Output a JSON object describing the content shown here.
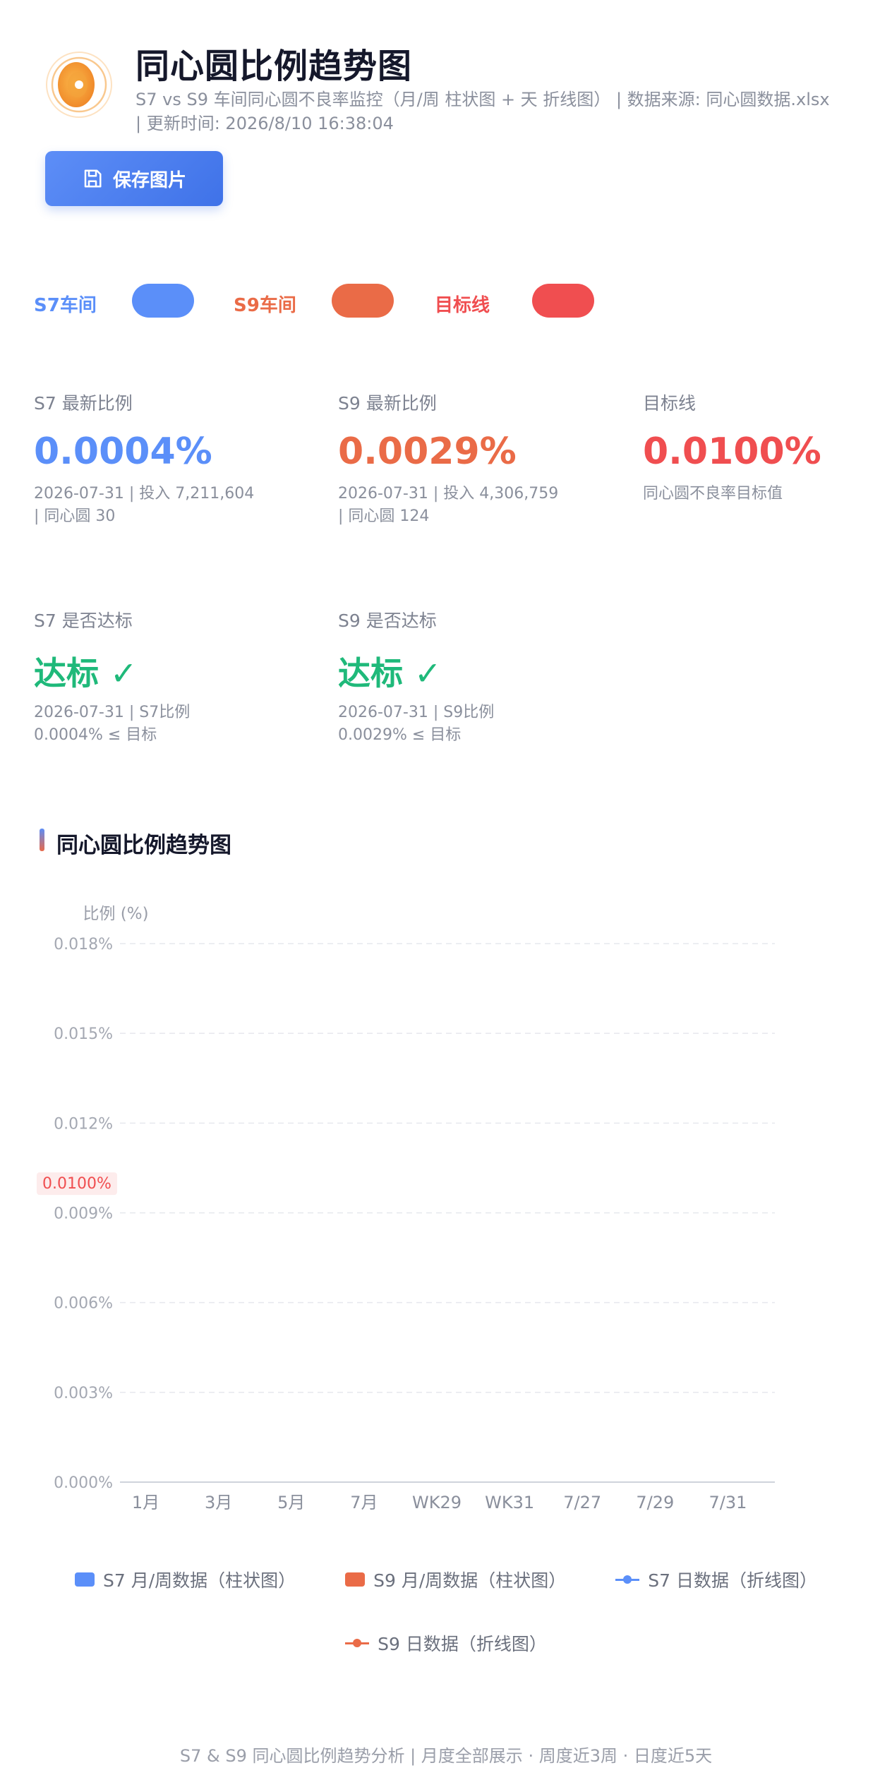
{
  "header": {
    "title": "同心圆比例趋势图",
    "subtitle": "S7 vs S9 车间同心圆不良率监控（月/周 柱状图 + 天 折线图） | 数据来源: 同心圆数据.xlsx | 更新时间: 2026/8/10 16:38:04",
    "save_label": "保存图片"
  },
  "toggles": [
    {
      "label": "S7车间",
      "color": "#5b8ff9"
    },
    {
      "label": "S9车间",
      "color": "#ea6b47"
    },
    {
      "label": "目标线",
      "color": "#f04e50"
    }
  ],
  "stats": {
    "s7_latest": {
      "label": "S7 最新比例",
      "value": "0.0004%",
      "detail_1": "2026-07-31 | 投入 7,211,604",
      "detail_2": "| 同心圆 30"
    },
    "s9_latest": {
      "label": "S9 最新比例",
      "value": "0.0029%",
      "detail_1": "2026-07-31 | 投入 4,306,759",
      "detail_2": "| 同心圆 124"
    },
    "target": {
      "label": "目标线",
      "value": "0.0100%",
      "detail_1": "同心圆不良率目标值"
    },
    "s7_pass": {
      "label": "S7 是否达标",
      "value": "达标 ✓",
      "detail_1": "2026-07-31 | S7比例",
      "detail_2": "0.0004% ≤ 目标"
    },
    "s9_pass": {
      "label": "S9 是否达标",
      "value": "达标 ✓",
      "detail_1": "2026-07-31 | S9比例",
      "detail_2": "0.0029% ≤ 目标"
    }
  },
  "colors": {
    "s7": "#5b8ff9",
    "s9": "#ea6b47",
    "target": "#f04e50",
    "pass": "#1fb97a"
  },
  "section": {
    "title": "同心圆比例趋势图"
  },
  "chart_data": {
    "type": "bar",
    "ylabel": "比例 (%)",
    "ylim": [
      0,
      0.018
    ],
    "yticks": [
      "0.000%",
      "0.003%",
      "0.006%",
      "0.009%",
      "0.012%",
      "0.015%",
      "0.018%"
    ],
    "ytick_values": [
      0,
      0.003,
      0.006,
      0.009,
      0.012,
      0.015,
      0.018
    ],
    "categories": [
      "1月",
      "3月",
      "5月",
      "7月",
      "WK29",
      "WK31",
      "7/27",
      "7/29",
      "7/31"
    ],
    "target_value": 0.01,
    "target_label": "0.0100%",
    "grid": true,
    "legend_position": "bottom",
    "series": []
  },
  "legend": [
    {
      "label": "S7 月/周数据（柱状图）",
      "kind": "bar",
      "color": "#5b8ff9"
    },
    {
      "label": "S9 月/周数据（柱状图）",
      "kind": "bar",
      "color": "#ea6b47"
    },
    {
      "label": "S7 日数据（折线图）",
      "kind": "line",
      "color": "#5b8ff9"
    },
    {
      "label": "S9 日数据（折线图）",
      "kind": "line",
      "color": "#ea6b47"
    }
  ],
  "footer": "S7 & S9 同心圆比例趋势分析 | 月度全部展示 · 周度近3周 · 日度近5天"
}
